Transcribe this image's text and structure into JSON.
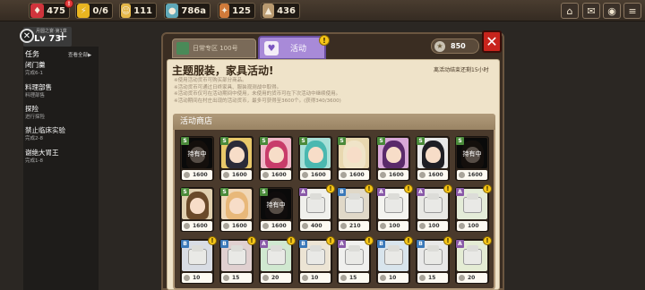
{
  "resources": [
    {
      "name": "heart-gem",
      "value": "475",
      "icon_color": "#d0343c",
      "glyph": "♦",
      "has_badge": true
    },
    {
      "name": "energy",
      "value": "0/6",
      "icon_color": "#e9b520",
      "glyph": "⚡",
      "has_badge": false
    },
    {
      "name": "stamina",
      "value": "111",
      "icon_color": "#e6b84a",
      "glyph": "☺",
      "has_badge": false
    },
    {
      "name": "gold",
      "value": "786a",
      "icon_color": "#5fa8b8",
      "glyph": "●",
      "has_badge": false
    },
    {
      "name": "item",
      "value": "125",
      "icon_color": "#d07a3a",
      "glyph": "✦",
      "has_badge": false
    },
    {
      "name": "wood",
      "value": "436",
      "icon_color": "#b99a70",
      "glyph": "▲",
      "has_badge": false
    }
  ],
  "top_buttons": [
    "home-icon",
    "mail-icon",
    "camera-icon",
    "menu-icon"
  ],
  "left_panel": {
    "level_caption": "月圆之宴·第1章",
    "level": "Lv 73",
    "tasks_title": "任务",
    "view_all": "查看全部▶",
    "tasks": [
      {
        "title": "闭门羹",
        "status": "完成6-1"
      },
      {
        "title": "料理部售",
        "status": "料理部售"
      },
      {
        "title": "探险",
        "status": "进行探险"
      },
      {
        "title": "禁止临床实验",
        "status": "完成2-8"
      },
      {
        "title": "谢绝大胃王",
        "status": "完成1-8"
      }
    ]
  },
  "window": {
    "tab_shop_label": "日常专区 100号",
    "tab_activity_label": "活动",
    "currency": "850",
    "title": "主题服装，家具活动!",
    "countdown": "离活动结束还剩15小时",
    "notes": [
      "※使用活动货币可购买部分商品。",
      "※活动货币可通过日终家具、服装观测战中取得。",
      "※活动货币仅可在活动期间中使用，未使用的货币可在下次活动中继续使用。",
      "※活动期间在村庄出现的活动货币，最多可获得至3600个。(获得340/3600)"
    ],
    "shop_title": "活动商店"
  },
  "colors": {
    "accent_purple": "#a88ad8",
    "close_red": "#c8241c",
    "badge_yellow": "#f5c518",
    "grade_s": "#4a8a3a",
    "grade_a": "#8a5aa8",
    "grade_b": "#3a78b8"
  },
  "cards": [
    [
      {
        "type": "owned",
        "grade": "S",
        "price": "1600",
        "owned_label": "持有中",
        "hair": "#3a2a22",
        "bg": "#1e1e1e",
        "badge": false
      },
      {
        "type": "char",
        "grade": "S",
        "price": "1600",
        "hair": "#2a2a38",
        "bg": "#e8c86a",
        "badge": false
      },
      {
        "type": "char",
        "grade": "S",
        "price": "1600",
        "hair": "#c83c6a",
        "bg": "#f0b8c8",
        "badge": false
      },
      {
        "type": "char",
        "grade": "S",
        "price": "1600",
        "hair": "#4ab8b0",
        "bg": "#a8e0d8",
        "badge": false
      },
      {
        "type": "char",
        "grade": "S",
        "price": "1600",
        "hair": "#f0e4c8",
        "bg": "#e8d8b0",
        "badge": false
      },
      {
        "type": "char",
        "grade": "S",
        "price": "1600",
        "hair": "#5a2a6a",
        "bg": "#d8a8d8",
        "badge": false
      },
      {
        "type": "char",
        "grade": "S",
        "price": "1600",
        "hair": "#1e1e24",
        "bg": "#e8e8e8",
        "badge": false
      },
      {
        "type": "owned",
        "grade": "S",
        "price": "1600",
        "owned_label": "持有中",
        "hair": "#3a2a22",
        "bg": "#1e1e1e",
        "badge": false
      }
    ],
    [
      {
        "type": "char",
        "grade": "S",
        "price": "1600",
        "hair": "#6a4a2a",
        "bg": "#e0d0b0",
        "badge": false
      },
      {
        "type": "char",
        "grade": "S",
        "price": "1600",
        "hair": "#e8b87a",
        "bg": "#f0d8b8",
        "badge": false
      },
      {
        "type": "owned",
        "grade": "S",
        "price": "1600",
        "owned_label": "持有中",
        "hair": "#2a2222",
        "bg": "#1e1e1e",
        "badge": false
      },
      {
        "type": "furn",
        "grade": "A",
        "price": "400",
        "bg": "#f0f0ec",
        "badge": true
      },
      {
        "type": "furn",
        "grade": "B",
        "price": "210",
        "bg": "#e0d8c8",
        "badge": true
      },
      {
        "type": "furn",
        "grade": "A",
        "price": "100",
        "bg": "#f4f4f0",
        "badge": true
      },
      {
        "type": "furn",
        "grade": "A",
        "price": "100",
        "bg": "#e8e8e4",
        "badge": true
      },
      {
        "type": "furn",
        "grade": "A",
        "price": "100",
        "bg": "#e4ecd8",
        "badge": true
      }
    ],
    [
      {
        "type": "furn",
        "grade": "B",
        "price": "10",
        "bg": "#d8dce4",
        "badge": true
      },
      {
        "type": "furn",
        "grade": "B",
        "price": "15",
        "bg": "#e0d0d0",
        "badge": true
      },
      {
        "type": "furn",
        "grade": "A",
        "price": "20",
        "bg": "#d0e8d0",
        "badge": true
      },
      {
        "type": "furn",
        "grade": "B",
        "price": "10",
        "bg": "#ece4d4",
        "badge": true
      },
      {
        "type": "furn",
        "grade": "A",
        "price": "15",
        "bg": "#f0f0ee",
        "badge": true
      },
      {
        "type": "furn",
        "grade": "B",
        "price": "10",
        "bg": "#d8e4ec",
        "badge": true
      },
      {
        "type": "furn",
        "grade": "B",
        "price": "15",
        "bg": "#e8e8e8",
        "badge": true
      },
      {
        "type": "furn",
        "grade": "A",
        "price": "20",
        "bg": "#e4ecd4",
        "badge": true
      }
    ]
  ]
}
